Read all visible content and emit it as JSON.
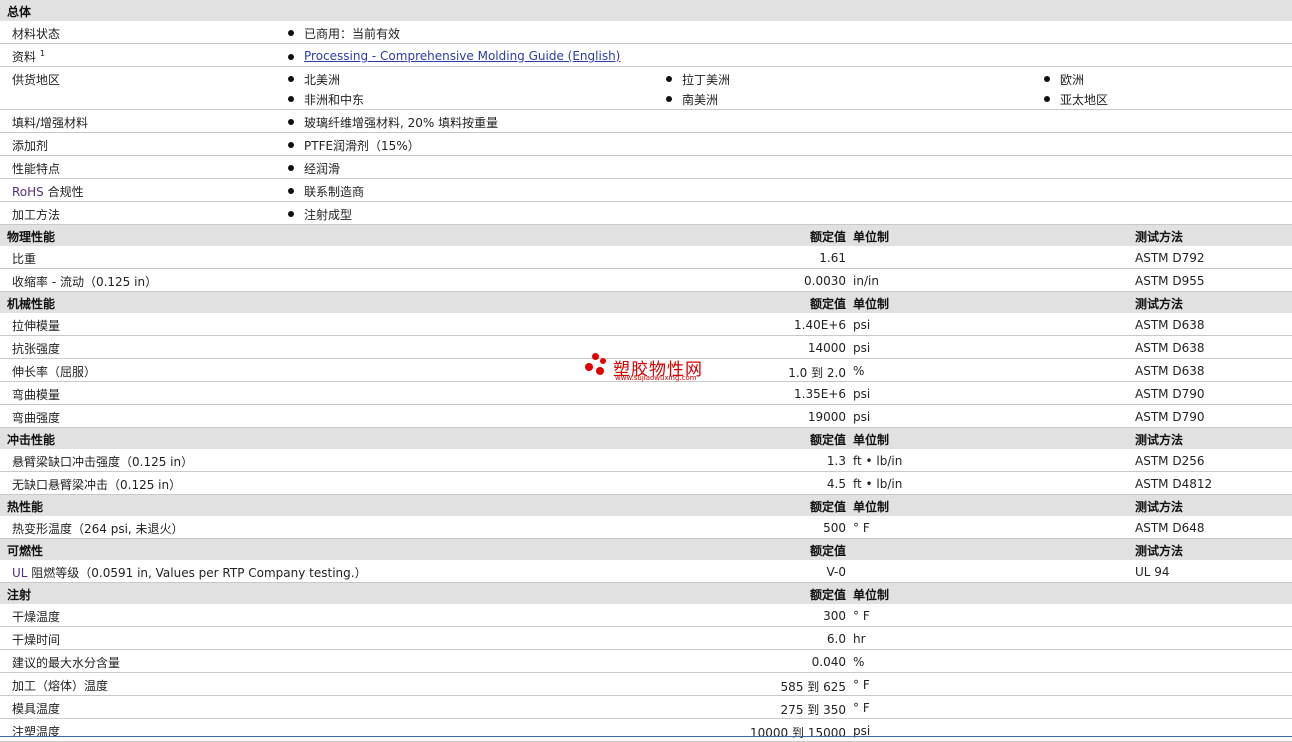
{
  "sections": {
    "general": {
      "title": "总体"
    },
    "physical": {
      "title": "物理性能"
    },
    "mechanical": {
      "title": "机械性能"
    },
    "impact": {
      "title": "冲击性能"
    },
    "thermal": {
      "title": "热性能"
    },
    "flammability": {
      "title": "可燃性"
    },
    "injection": {
      "title": "注射"
    }
  },
  "headers": {
    "rated": "额定值",
    "unit": "单位制",
    "test": "测试方法"
  },
  "general": {
    "status_label": "材料状态",
    "status_value": "已商用：当前有效",
    "docs_label": "资料",
    "docs_sup": "1",
    "docs_link": "Processing - Comprehensive Molding Guide (English)",
    "regions_label": "供货地区",
    "regions": [
      "北美洲",
      "拉丁美洲",
      "欧洲",
      "非洲和中东",
      "南美洲",
      "亚太地区"
    ],
    "filler_label": "填料/增强材料",
    "filler_value": "玻璃纤维增强材料, 20% 填料按重量",
    "additive_label": "添加剂",
    "additive_value": "PTFE润滑剂（15%）",
    "features_label": "性能特点",
    "features_value": "经润滑",
    "rohs_label_a": "RoHS",
    "rohs_label_b": " 合规性",
    "rohs_value": "联系制造商",
    "process_label": "加工方法",
    "process_value": "注射成型"
  },
  "physical_rows": [
    {
      "label": "比重",
      "value": "1.61",
      "unit": "",
      "test": "ASTM D792"
    },
    {
      "label": "收缩率  - 流动（0.125 in）",
      "value": "0.0030",
      "unit": "in/in",
      "test": "ASTM D955"
    }
  ],
  "mechanical_rows": [
    {
      "label": "拉伸模量",
      "value": "1.40E+6",
      "unit": "psi",
      "test": "ASTM D638"
    },
    {
      "label": "抗张强度",
      "value": "14000",
      "unit": "psi",
      "test": "ASTM D638"
    },
    {
      "label": "伸长率（屈服）",
      "value": "1.0 到  2.0",
      "unit": "%",
      "test": "ASTM D638"
    },
    {
      "label": "弯曲模量",
      "value": "1.35E+6",
      "unit": "psi",
      "test": "ASTM D790"
    },
    {
      "label": "弯曲强度",
      "value": "19000",
      "unit": "psi",
      "test": "ASTM D790"
    }
  ],
  "impact_rows": [
    {
      "label": "悬臂梁缺口冲击强度（0.125 in）",
      "value": "1.3",
      "unit": "ft • lb/in",
      "test": "ASTM D256"
    },
    {
      "label": "无缺口悬臂梁冲击（0.125 in）",
      "value": "4.5",
      "unit": "ft • lb/in",
      "test": "ASTM D4812"
    }
  ],
  "thermal_rows": [
    {
      "label": "热变形温度（264 psi, 未退火）",
      "value": "500",
      "unit": "° F",
      "test": "ASTM D648"
    }
  ],
  "flammability_rows": [
    {
      "label_a": "UL",
      "label_b": " 阻燃等级（0.0591 in, Values per RTP Company testing.）",
      "value": "V-0",
      "unit": "",
      "test": "UL 94"
    }
  ],
  "injection_rows": [
    {
      "label": "干燥温度",
      "value": "300",
      "unit": "° F",
      "test": ""
    },
    {
      "label": "干燥时间",
      "value": "6.0",
      "unit": "hr",
      "test": ""
    },
    {
      "label": "建议的最大水分含量",
      "value": "0.040",
      "unit": "%",
      "test": ""
    },
    {
      "label": "加工（熔体）温度",
      "value": "585 到  625",
      "unit": "° F",
      "test": ""
    },
    {
      "label": "模具温度",
      "value": "275 到  350",
      "unit": "° F",
      "test": ""
    },
    {
      "label": "注塑温度",
      "value": "10000 到  15000",
      "unit": "psi",
      "test": ""
    }
  ],
  "watermark": {
    "title": "塑胶物性网",
    "url": "www.sujiaowuxing.com",
    "color": "#d40000"
  }
}
